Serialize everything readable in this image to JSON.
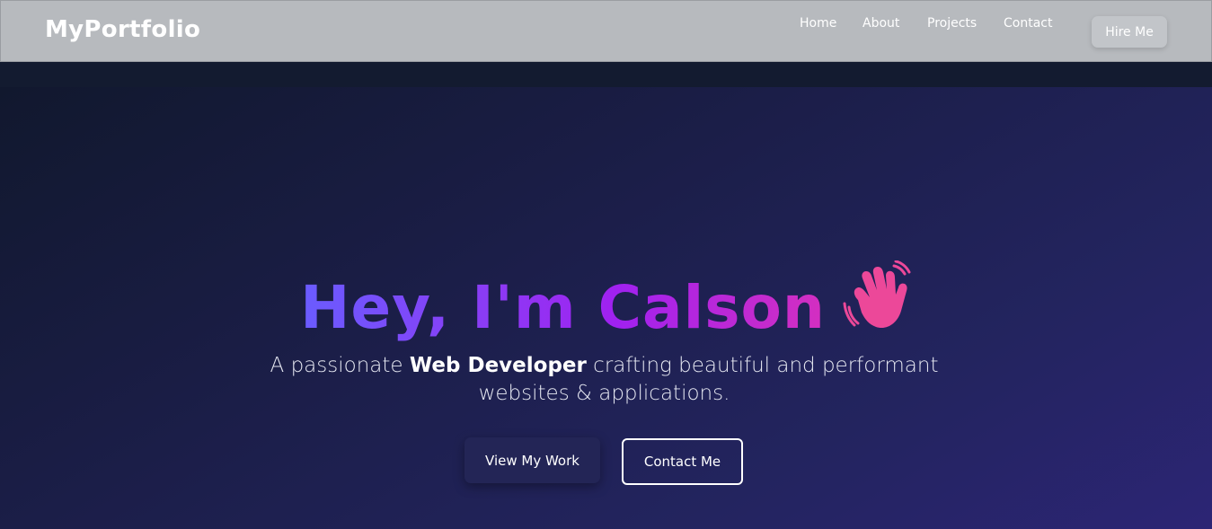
{
  "header": {
    "logo": "MyPortfolio",
    "nav": [
      {
        "label": "Home"
      },
      {
        "label": "About"
      },
      {
        "label": "Projects"
      },
      {
        "label": "Contact"
      }
    ],
    "cta_label": "Hire Me"
  },
  "hero": {
    "greeting": "Hey, I'm Calson",
    "wave_icon": "waving-hand-icon",
    "subtitle_before": "A passionate ",
    "subtitle_bold": "Web Developer",
    "subtitle_after": " crafting beautiful and performant websites & applications.",
    "primary_button": "View My Work",
    "secondary_button": "Contact Me"
  },
  "colors": {
    "gradient_start": "#6a5cff",
    "gradient_mid": "#a021f0",
    "gradient_end": "#ec4899",
    "navbar_bg": "#b7babe",
    "hero_bg": "#1e1f52"
  }
}
